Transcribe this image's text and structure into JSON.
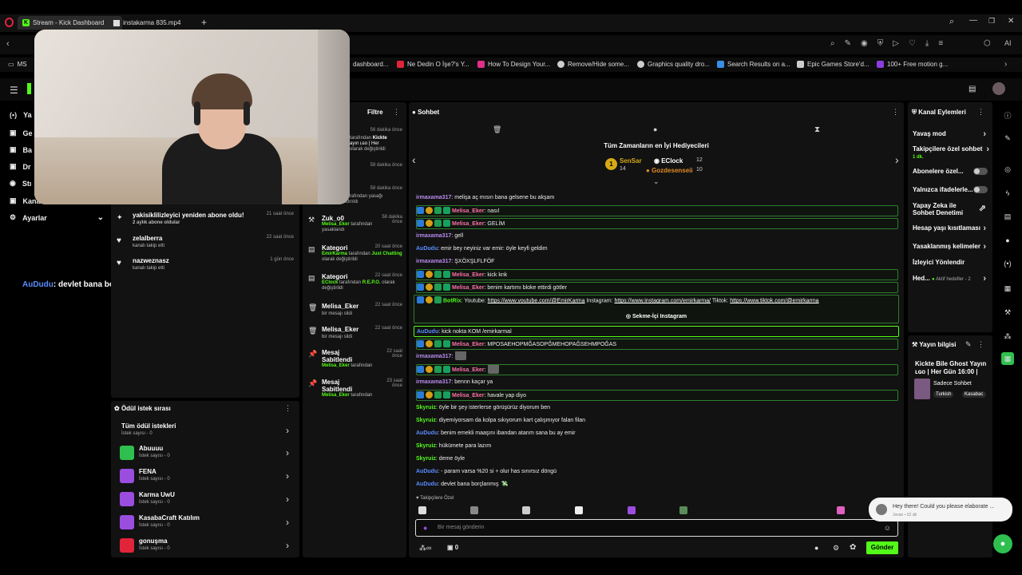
{
  "browser": {
    "tab1": "Stream - Kick Dashboard",
    "tab2": "instakarma 835.mp4",
    "bookmarks": [
      "MS",
      "dashboard...",
      "Ne Dedin O İşe?'s Y...",
      "How To Design Your...",
      "Remove/Hide some...",
      "Graphics quality dro...",
      "Search Results on a...",
      "Epic Games Store'd...",
      "100+ Free motion g..."
    ]
  },
  "leftnav": {
    "items": [
      "Ya",
      "Ge",
      "Ba",
      "Dr",
      "Stı",
      "Kanal"
    ],
    "settings": "Ayarlar",
    "overlay_user": "AuDudu",
    "overlay_text": ": devlet bana borçlanmış"
  },
  "activity": [
    {
      "title": "yakisiklilizleyici yeniden abone oldu!",
      "sub": "2 aylık abone oldular",
      "time": "21 saat önce",
      "icon": "star"
    },
    {
      "title": "zelalberra",
      "sub": "kanalı takip etti",
      "time": "22 saat önce",
      "icon": "heart"
    },
    {
      "title": "nazweznasz",
      "sub": "kanalı takip etti",
      "time": "1 gün önce",
      "icon": "heart"
    }
  ],
  "rewards": {
    "title": "Ödül istek sırası",
    "all": "Tüm ödül istekleri",
    "all_sub": "İstek sayısı - 0",
    "items": [
      {
        "name": "Abuuuu",
        "sub": "İstek sayısı - 0",
        "color": "#2fbf4f"
      },
      {
        "name": "FENA",
        "sub": "İstek sayısı - 0",
        "color": "#9b4de0"
      },
      {
        "name": "Karma UwU",
        "sub": "İstek sayısı - 0",
        "color": "#9b4de0"
      },
      {
        "name": "KasabaCraft Katılım",
        "sub": "İstek sayısı - 0",
        "color": "#9b4de0"
      },
      {
        "name": "gonuşma",
        "sub": "İstek sayısı - 0",
        "color": "#e0243a"
      }
    ]
  },
  "modlog": {
    "filter": "Filtre",
    "items": [
      {
        "pre": "",
        "time": "56 dakika önce",
        "l1": "tarafından",
        "l1g": "Kickte",
        "l2": "ayın ʟɢᴏ | Her",
        "l3": "olarak değiştirildi",
        "icon": ""
      },
      {
        "time": "58 dakika önce",
        "l1": "",
        "l2": "",
        "l3": "",
        "icon": ""
      },
      {
        "time": "58 dakika önce",
        "l1": "er tarafından yasağı",
        "l2": "kaldırıldı",
        "l3": "",
        "icon": ""
      },
      {
        "title": "Zuk_o0",
        "time": "58 dakika önce",
        "g": "Melisa_Eker",
        "l1": " tarafından",
        "l2": "yasaklandı",
        "icon": "🔨"
      },
      {
        "title": "Kategori",
        "time": "20 saat önce",
        "g": "EmirKarma",
        "l1": " tarafından ",
        "g2": "Just Chatting",
        "l2": " olarak değiştirildi",
        "icon": "▤"
      },
      {
        "title": "Kategori",
        "time": "22 saat önce",
        "g": "EClock",
        "l1": " tarafından ",
        "g2": "R.E.P.O.",
        "l2": " olarak değiştirildi",
        "icon": "▤"
      },
      {
        "title": "Melisa_Eker",
        "time": "22 saat önce",
        "l1": "bir mesajı sildi",
        "icon": "🗑"
      },
      {
        "title": "Melisa_Eker",
        "time": "22 saat önce",
        "l1": "bir mesajı sildi",
        "icon": "🗑"
      },
      {
        "title": "Mesaj Sabitlendi",
        "time": "22 saat önce",
        "g": "Melisa_Eker",
        "l1": " tarafından",
        "icon": "📌"
      },
      {
        "title": "Mesaj Sabitlendi",
        "time": "23 saat önce",
        "g": "Melisa_Eker",
        "l1": " tarafından",
        "icon": "📌"
      }
    ]
  },
  "chat": {
    "title": "Sohbet",
    "gifters_title": "Tüm Zamanların en İyi Hediyecileri",
    "gifters": [
      {
        "rank": "1",
        "name": "SenSar",
        "amount": "14"
      },
      {
        "rank": "",
        "name": "EClock",
        "amount": "12"
      },
      {
        "rank": "",
        "name": "Gozdesenseii",
        "amount": "10"
      }
    ],
    "messages": [
      {
        "user": "irmaxama317",
        "color": "#b98cf0",
        "text": ": melişa aç mısın bana gelsene bu akşam",
        "badges": 0,
        "hl": false
      },
      {
        "user": "Melisa_Eker",
        "color": "#ff6fa8",
        "text": ": nasıl",
        "badges": 4,
        "hl": true
      },
      {
        "user": "Melisa_Eker",
        "color": "#ff6fa8",
        "text": ": GELİM",
        "badges": 4,
        "hl": true
      },
      {
        "user": "irmaxama317",
        "color": "#b98cf0",
        "text": ": gell",
        "badges": 0,
        "hl": false
      },
      {
        "user": "AuDudu",
        "color": "#5a8cff",
        "text": ": emir bey neyiniz var emir: öyle keyfi geldim",
        "badges": 0,
        "hl": false
      },
      {
        "user": "irmaxama317",
        "color": "#b98cf0",
        "text": ": ŞXÖXŞLFLFÖF",
        "badges": 0,
        "hl": false
      },
      {
        "user": "Melisa_Eker",
        "color": "#ff6fa8",
        "text": ": kick knk",
        "badges": 4,
        "hl": true
      },
      {
        "user": "Melisa_Eker",
        "color": "#ff6fa8",
        "text": ": benim kartımı bloke ettirdi götler",
        "badges": 4,
        "hl": true
      }
    ],
    "botrix_user": "BotRix",
    "botrix_text": ": Youtube: ",
    "yt": "https://www.youtube.com/@EmirKarma",
    "ig_label": " Instagram: ",
    "ig": "https://www.instagram.com/emirkarma/",
    "tt_label": " Tiktok: ",
    "tt": "https://www.tiktok.com/@emirkarma",
    "insta_btn": "Sekme-İçi Instagram",
    "messages2": [
      {
        "user": "AuDudu",
        "color": "#5a8cff",
        "text": ": kick nokta KOM /emirkarmal",
        "badges": 0,
        "hl": true
      },
      {
        "user": "Melisa_Eker",
        "color": "#ff6fa8",
        "text": ": MPOSAEHOPMĞASOPĞMEHOPAĞSEHMPOĞAS",
        "badges": 4,
        "hl": true
      },
      {
        "user": "irmaxama317",
        "color": "#b98cf0",
        "text": ":",
        "badges": 0,
        "hl": false
      },
      {
        "user": "Melisa_Eker",
        "color": "#ff6fa8",
        "text": ":",
        "badges": 4,
        "hl": true
      },
      {
        "user": "irmaxama317",
        "color": "#b98cf0",
        "text": ": bennn kaçar ya",
        "badges": 0,
        "hl": false
      },
      {
        "user": "Melisa_Eker",
        "color": "#ff6fa8",
        "text": ": havale yap diyo",
        "badges": 4,
        "hl": true
      },
      {
        "user": "Skyruiz",
        "color": "#53fc18",
        "text": ": öyle bir şey isterlerse görüşürüz diyorum ben",
        "badges": 0,
        "hl": false
      },
      {
        "user": "Skyruiz",
        "color": "#53fc18",
        "text": ": diyemiyorsam da kolpa sıkıyorum kart çalışmıyor falan filan",
        "badges": 0,
        "hl": false
      },
      {
        "user": "AuDudu",
        "color": "#5a8cff",
        "text": ": benim emekli maaşını ibandan atarım sana bu ay emir",
        "badges": 0,
        "hl": false
      },
      {
        "user": "Skyruiz",
        "color": "#53fc18",
        "text": ": hükümete para lazım",
        "badges": 0,
        "hl": false
      },
      {
        "user": "Skyruiz",
        "color": "#53fc18",
        "text": ": deme öyle",
        "badges": 0,
        "hl": false
      },
      {
        "user": "AuDudu",
        "color": "#5a8cff",
        "text": ": - param varsa %20 si + olur has sınırsız döngü",
        "badges": 0,
        "hl": false
      },
      {
        "user": "AuDudu",
        "color": "#5a8cff",
        "text": ": devlet bana borçlanmış",
        "badges": 0,
        "hl": false
      }
    ],
    "followers_only": "Takipçilere Özel",
    "input_placeholder": "Bir mesaj gönderin",
    "points": "0",
    "send": "Gönder"
  },
  "actions": {
    "title": "Kanal Eylemleri",
    "items": [
      "Yavaş mod",
      "Takipçilere özel sohbet",
      "Abonelere özel...",
      "Yalnızca ifadelerle...",
      "Yapay Zeka ile Sohbet Denetimi",
      "Hesap yaşı kısıtlaması",
      "Yasaklanmış kelimeler",
      "İzleyici Yönlendir",
      "Hed..."
    ],
    "follow_sub": "1 dk.",
    "goals_sub": "Aktif hedefler - 2"
  },
  "stream": {
    "title": "Yayın bilgisi",
    "name": "Kickte Bile Ghost Yayın ʟɢᴏ | Her Gün 16:00 |",
    "category": "Sadece Sohbet",
    "tags": [
      "Turkish",
      "Kasabac"
    ]
  },
  "toast": {
    "text": "Hey there!  Could you please elaborate ...",
    "sub": "Jovan • 52 dk"
  }
}
